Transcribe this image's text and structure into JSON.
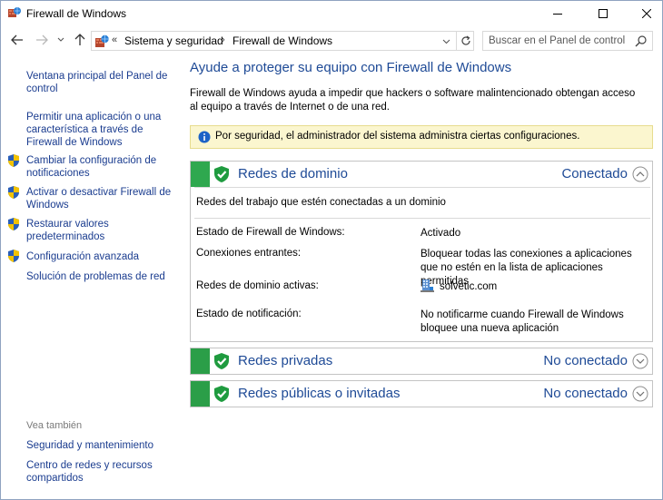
{
  "window": {
    "title": "Firewall de Windows"
  },
  "nav": {
    "breadcrumbs": [
      "Sistema y seguridad",
      "Firewall de Windows"
    ],
    "search_placeholder": "Buscar en el Panel de control"
  },
  "sidebar": {
    "links": [
      {
        "label": "Ventana principal del Panel de control",
        "shield": false
      },
      {
        "label": "Permitir una aplicación o una característica a través de Firewall de Windows",
        "shield": false
      },
      {
        "label": "Cambiar la configuración de notificaciones",
        "shield": true
      },
      {
        "label": "Activar o desactivar Firewall de Windows",
        "shield": true
      },
      {
        "label": "Restaurar valores predeterminados",
        "shield": true
      },
      {
        "label": "Configuración avanzada",
        "shield": true
      },
      {
        "label": "Solución de problemas de red",
        "shield": false
      }
    ],
    "see_also_heading": "Vea también",
    "see_also": [
      {
        "label": "Seguridad y mantenimiento"
      },
      {
        "label": "Centro de redes y recursos compartidos"
      }
    ]
  },
  "main": {
    "title": "Ayude a proteger su equipo con Firewall de Windows",
    "intro": "Firewall de Windows ayuda a impedir que hackers o software malintencionado obtengan acceso al equipo a través de Internet o de una red.",
    "info_bar": "Por seguridad, el administrador del sistema administra ciertas configuraciones.",
    "sections": [
      {
        "title": "Redes de dominio",
        "status": "Conectado",
        "expanded": true,
        "description": "Redes del trabajo que estén conectadas a un dominio",
        "rows": [
          {
            "label": "Estado de Firewall de Windows:",
            "value": "Activado"
          },
          {
            "label": "Conexiones entrantes:",
            "value": "Bloquear todas las conexiones a aplicaciones que no estén en la lista de aplicaciones permitidas"
          },
          {
            "label": "Redes de dominio activas:",
            "value": "solvetic.com"
          },
          {
            "label": "Estado de notificación:",
            "value": "No notificarme cuando Firewall de Windows bloquee una nueva aplicación"
          }
        ]
      },
      {
        "title": "Redes privadas",
        "status": "No conectado",
        "expanded": false
      },
      {
        "title": "Redes públicas o invitadas",
        "status": "No conectado",
        "expanded": false
      }
    ]
  },
  "colors": {
    "link": "#1a3c8f",
    "heading": "#1e4a96",
    "green": "#2fa84f",
    "info_bg": "#fbf6cf"
  }
}
